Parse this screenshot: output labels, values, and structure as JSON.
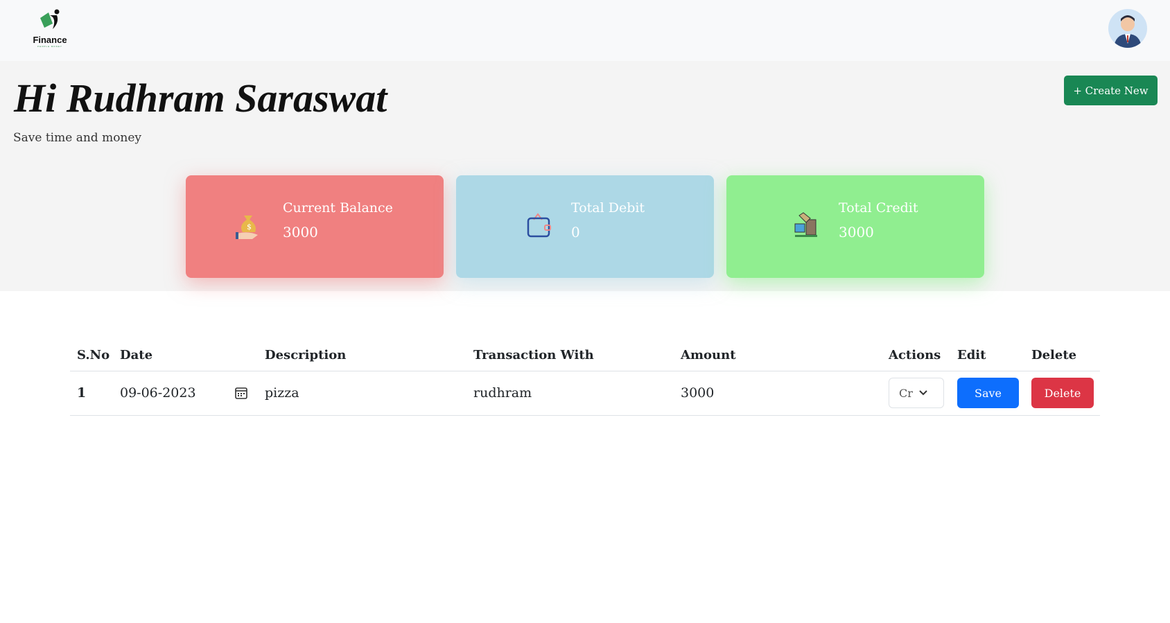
{
  "header": {
    "logo_name": "Finance",
    "logo_tagline": "PEOPLE MONEY"
  },
  "hero": {
    "title": "Hi Rudhram Saraswat",
    "subtitle": "Save time and money",
    "create_label": "+ Create New"
  },
  "cards": [
    {
      "label": "Current Balance",
      "value": "3000",
      "icon": "money-bag-icon",
      "color": "#f08080"
    },
    {
      "label": "Total Debit",
      "value": "0",
      "icon": "wallet-icon",
      "color": "#add8e6"
    },
    {
      "label": "Total Credit",
      "value": "3000",
      "icon": "credit-icon",
      "color": "#90ee90"
    }
  ],
  "table": {
    "headers": [
      "S.No",
      "Date",
      "Description",
      "Transaction With",
      "Amount",
      "Actions",
      "Edit",
      "Delete"
    ],
    "rows": [
      {
        "sno": "1",
        "date": "09-06-2023",
        "description": "pizza",
        "with": "rudhram",
        "amount": "3000",
        "action": "Cr",
        "edit": "Save",
        "delete": "Delete"
      }
    ]
  }
}
